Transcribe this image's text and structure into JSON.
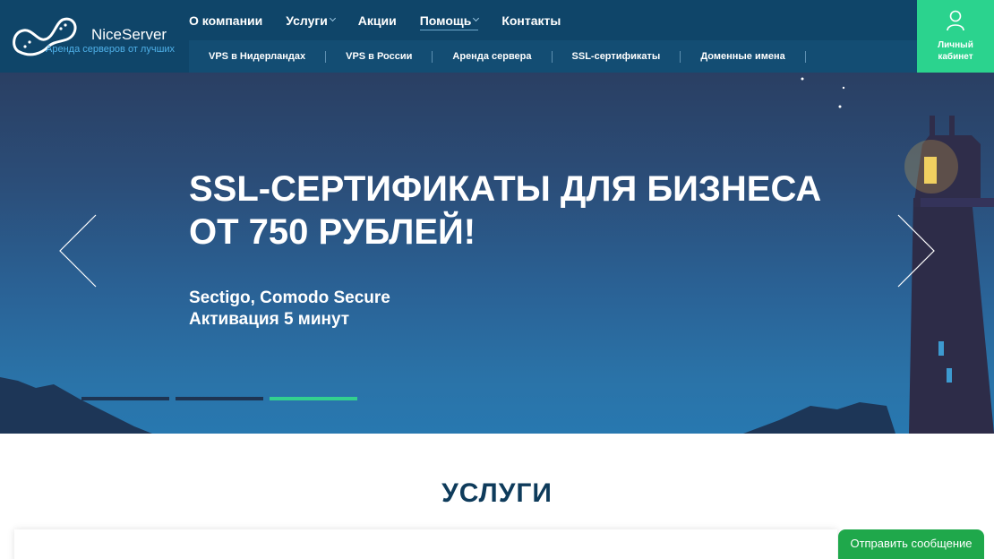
{
  "brand": {
    "name": "NiceServer",
    "tagline": "Аренда серверов от лучших",
    "accent": "#2bd38e",
    "header_color": "#0f4569"
  },
  "nav": {
    "items": [
      {
        "label": "О компании",
        "dropdown": false,
        "active": false
      },
      {
        "label": "Услуги",
        "dropdown": true,
        "active": false
      },
      {
        "label": "Акции",
        "dropdown": false,
        "active": false
      },
      {
        "label": "Помощь",
        "dropdown": true,
        "active": true
      },
      {
        "label": "Контакты",
        "dropdown": false,
        "active": false
      }
    ],
    "sub_items": [
      {
        "label": "VPS в Нидерландах"
      },
      {
        "label": "VPS в России"
      },
      {
        "label": "Аренда сервера"
      },
      {
        "label": "SSL-сертификаты"
      },
      {
        "label": "Доменные имена"
      }
    ]
  },
  "cabinet": {
    "line1": "Личный",
    "line2": "кабинет",
    "icon": "user-icon"
  },
  "hero": {
    "title": "SSL-СЕРТИФИКАТЫ ДЛЯ БИЗНЕСА ОТ 750 РУБЛЕЙ!",
    "subtitle_line1": "Sectigo, Comodo Secure",
    "subtitle_line2": "Активация 5 минут",
    "slides_count": 3,
    "active_slide": 3,
    "active_color": "#33d08f"
  },
  "services": {
    "title": "УСЛУГИ"
  },
  "chat": {
    "label": "Отправить сообщение",
    "color": "#1fa84b"
  }
}
